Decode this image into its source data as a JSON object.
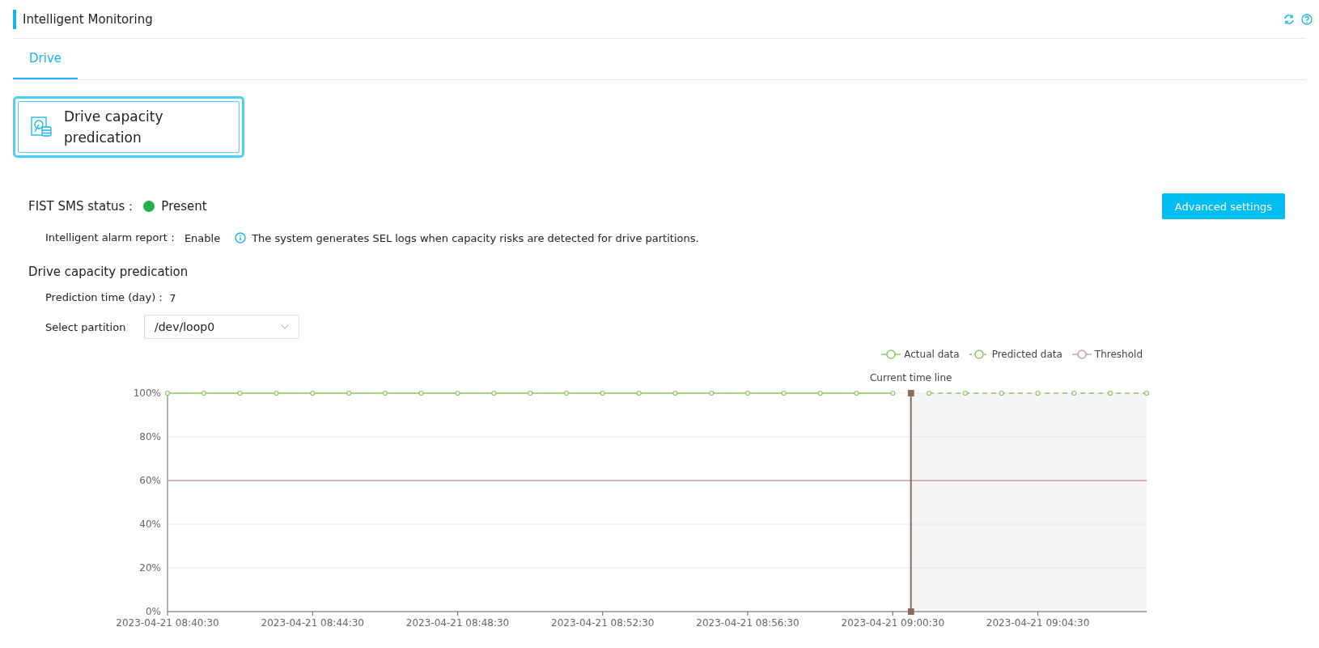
{
  "header": {
    "title": "Intelligent Monitoring"
  },
  "tabs": [
    {
      "label": "Drive",
      "selected": true
    }
  ],
  "feature_cards": [
    {
      "label": "Drive capacity predication",
      "selected": true
    }
  ],
  "status": {
    "label": "FIST SMS status：",
    "value": "Present",
    "color": "#22b14c"
  },
  "advanced_button": "Advanced settings",
  "alarm": {
    "label": "Intelligent alarm report：",
    "value": "Enable",
    "info": "The system generates SEL logs when capacity risks are detected for drive partitions."
  },
  "section_title": "Drive capacity predication",
  "prediction": {
    "label": "Prediction time (day)：",
    "value": "7"
  },
  "partition": {
    "label": "Select partition",
    "value": "/dev/loop0"
  },
  "chart_data": {
    "type": "line",
    "x": [
      "2023-04-21 08:40:30",
      "2023-04-21 08:41:30",
      "2023-04-21 08:42:30",
      "2023-04-21 08:43:30",
      "2023-04-21 08:44:30",
      "2023-04-21 08:45:30",
      "2023-04-21 08:46:30",
      "2023-04-21 08:47:30",
      "2023-04-21 08:48:30",
      "2023-04-21 08:49:30",
      "2023-04-21 08:50:30",
      "2023-04-21 08:51:30",
      "2023-04-21 08:52:30",
      "2023-04-21 08:53:30",
      "2023-04-21 08:54:30",
      "2023-04-21 08:55:30",
      "2023-04-21 08:56:30",
      "2023-04-21 08:57:30",
      "2023-04-21 08:58:30",
      "2023-04-21 08:59:30",
      "2023-04-21 09:00:30",
      "2023-04-21 09:01:30",
      "2023-04-21 09:02:30",
      "2023-04-21 09:03:30",
      "2023-04-21 09:04:30",
      "2023-04-21 09:05:30",
      "2023-04-21 09:06:30",
      "2023-04-21 09:07:30"
    ],
    "series": [
      {
        "name": "Actual data",
        "color": "#8cc864",
        "line_style": "solid",
        "marker": "circle",
        "values": [
          100,
          100,
          100,
          100,
          100,
          100,
          100,
          100,
          100,
          100,
          100,
          100,
          100,
          100,
          100,
          100,
          100,
          100,
          100,
          100,
          100,
          null,
          null,
          null,
          null,
          null,
          null,
          null
        ]
      },
      {
        "name": "Predicted data",
        "color": "#8cc864",
        "line_style": "dashed",
        "marker": "circle",
        "values": [
          null,
          null,
          null,
          null,
          null,
          null,
          null,
          null,
          null,
          null,
          null,
          null,
          null,
          null,
          null,
          null,
          null,
          null,
          null,
          null,
          null,
          100,
          100,
          100,
          100,
          100,
          100,
          100
        ]
      },
      {
        "name": "Threshold",
        "color": "#c8a0aa",
        "line_style": "solid",
        "values": [
          60,
          60,
          60,
          60,
          60,
          60,
          60,
          60,
          60,
          60,
          60,
          60,
          60,
          60,
          60,
          60,
          60,
          60,
          60,
          60,
          60,
          60,
          60,
          60,
          60,
          60,
          60,
          60
        ]
      }
    ],
    "xlim": [
      "2023-04-21 08:40:30",
      "2023-04-21 09:07:30"
    ],
    "ylim": [
      0,
      100
    ],
    "yticks": [
      {
        "value": 0,
        "label": "0%"
      },
      {
        "value": 20,
        "label": "20%"
      },
      {
        "value": 40,
        "label": "40%"
      },
      {
        "value": 60,
        "label": "60%"
      },
      {
        "value": 80,
        "label": "80%"
      },
      {
        "value": 100,
        "label": "100%"
      }
    ],
    "xticks": [
      "2023-04-21 08:40:30",
      "2023-04-21 08:44:30",
      "2023-04-21 08:48:30",
      "2023-04-21 08:52:30",
      "2023-04-21 08:56:30",
      "2023-04-21 09:00:30",
      "2023-04-21 09:04:30"
    ],
    "grid": "y",
    "legend": true,
    "ref_lines": [
      {
        "axis": "x",
        "value": "2023-04-21 09:01:00",
        "label": "Current time line",
        "color": "#8b6b5e"
      }
    ],
    "bands": [
      {
        "axis": "x",
        "from": "2023-04-21 09:01:00",
        "to": "2023-04-21 09:07:30",
        "color": "#f5f5f5"
      }
    ]
  }
}
